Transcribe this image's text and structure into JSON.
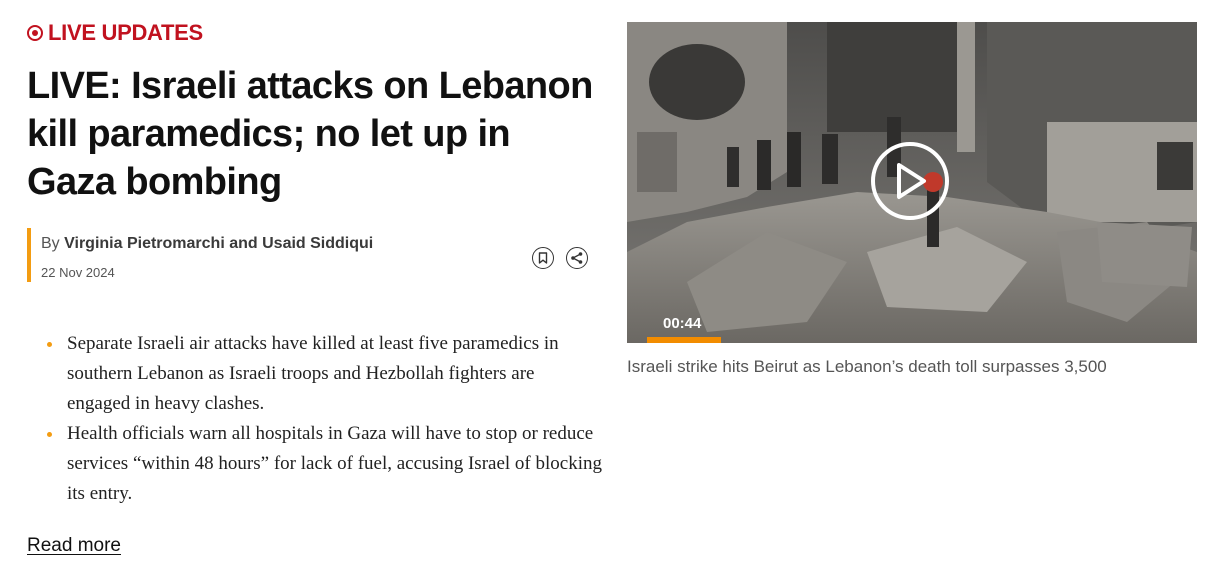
{
  "live_badge": {
    "label": "LIVE UPDATES",
    "color": "#c1121f"
  },
  "headline": "LIVE: Israeli attacks on Lebanon kill paramedics; no let up in Gaza bombing",
  "byline": {
    "by": "By",
    "authors": "Virginia Pietromarchi and Usaid Siddiqui",
    "date": "22 Nov 2024",
    "accent_color": "#f39c12"
  },
  "actions": {
    "bookmark_icon": "bookmark-icon",
    "share_icon": "share-icon"
  },
  "bullets": [
    "Separate Israeli air attacks have killed at least five paramedics in southern Lebanon as Israeli troops and Hezbollah fighters are engaged in heavy clashes.",
    "Health officials warn all hospitals in Gaza will have to stop or reduce services “within 48 hours” for lack of fuel, accusing Israel of blocking its entry."
  ],
  "read_more": "Read more",
  "video": {
    "timecode": "00:44",
    "progress_fraction": 0.14,
    "progress_color": "#f28c00",
    "caption": "Israeli strike hits Beirut as Lebanon’s death toll surpasses 3,500",
    "play_icon": "play-icon"
  }
}
